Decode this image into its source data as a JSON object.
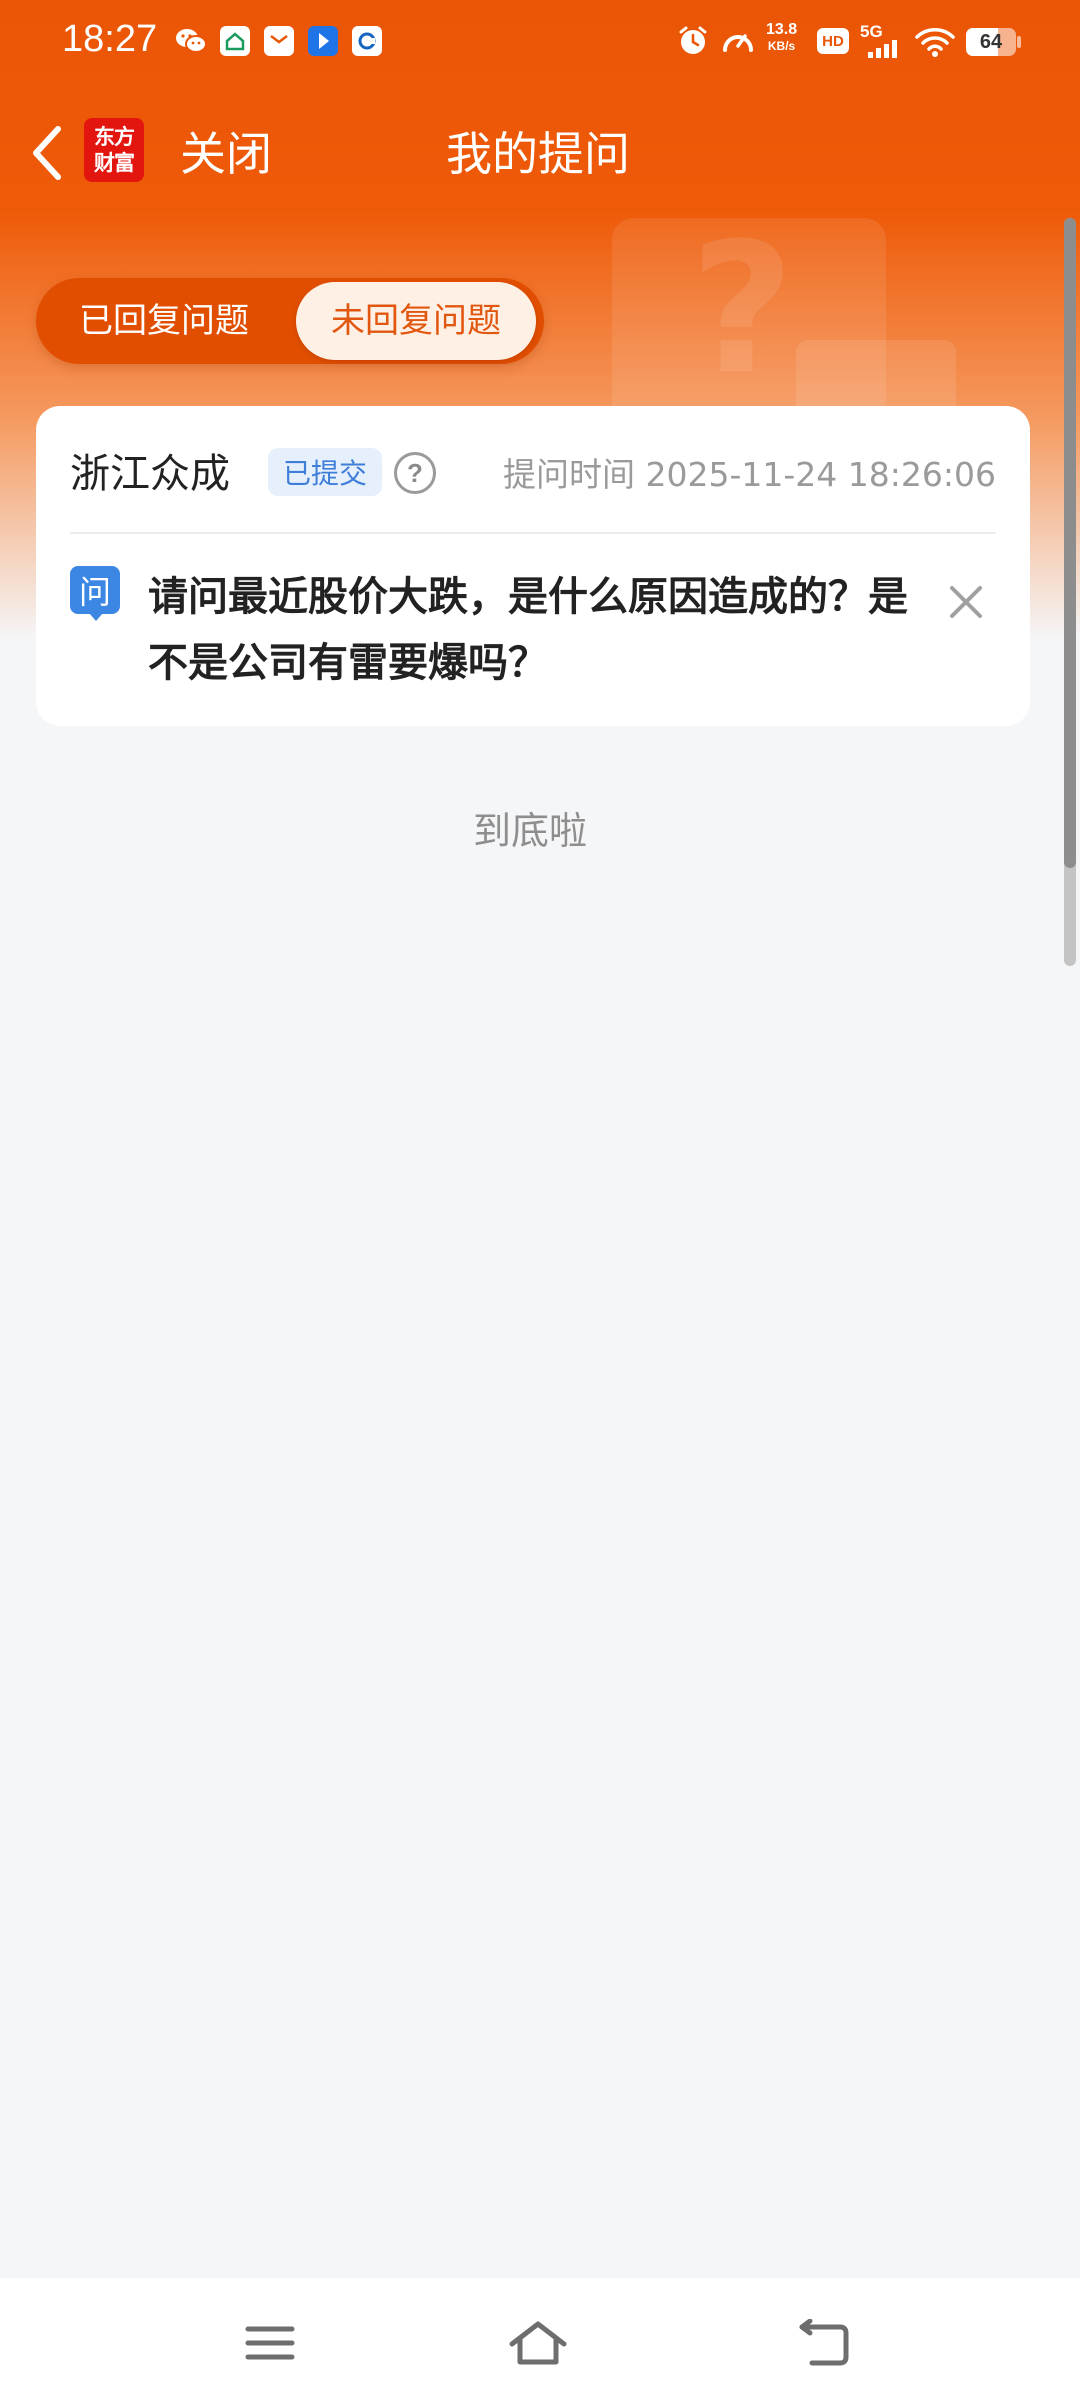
{
  "status_bar": {
    "time": "18:27",
    "apps": [
      "wechat-icon",
      "home-app-icon",
      "mail-app-icon",
      "bookmark-app-icon",
      "browser-app-icon"
    ],
    "net_speed_value": "13.8",
    "net_speed_unit": "KB/s",
    "hd": "HD",
    "network": "5G",
    "battery": "64",
    "battery_level_pct": 64
  },
  "nav": {
    "logo_line1": "东方",
    "logo_line2": "财富",
    "close_label": "关闭",
    "title": "我的提问"
  },
  "tabs": {
    "replied": "已回复问题",
    "unreplied": "未回复问题",
    "active": "unreplied"
  },
  "question_card": {
    "company": "浙江众成",
    "status_badge": "已提交",
    "help_symbol": "?",
    "ask_time": "提问时间 2025-11-24 18:26:06",
    "question_marker": "问",
    "question_text": "请问最近股价大跌，是什么原因造成的？是不是公司有雷要爆吗？"
  },
  "list_end": "到底啦",
  "colors": {
    "brand_orange": "#ea5606",
    "tab_active_text": "#e2570f",
    "badge_blue": "#3e7ed8",
    "question_icon_blue": "#3c87e4"
  }
}
